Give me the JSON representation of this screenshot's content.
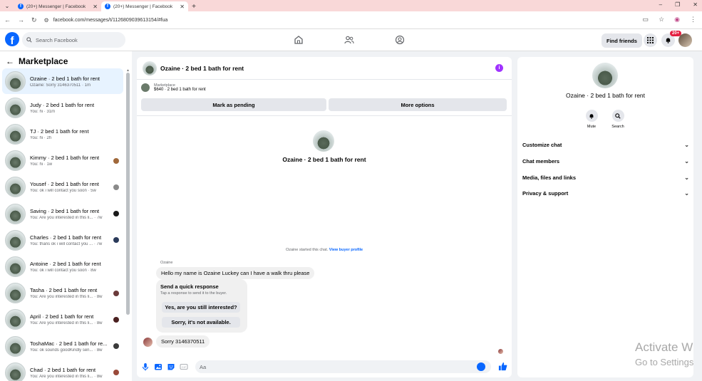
{
  "browser": {
    "tabs": [
      {
        "title": "(20+) Messenger | Facebook",
        "active": false
      },
      {
        "title": "(20+) Messenger | Facebook",
        "active": true
      }
    ],
    "url": "facebook.com/messages/t/1126809039613154/#fua"
  },
  "header": {
    "logo": "f",
    "search_placeholder": "Search Facebook",
    "find_friends": "Find friends",
    "notification_badge": "20+"
  },
  "sidebar": {
    "title": "Marketplace",
    "conversations": [
      {
        "name": "Ozaine · 2 bed 1 bath for rent",
        "preview": "Ozaine: Sorry 3146370511 · 1m",
        "active": true,
        "mini": ""
      },
      {
        "name": "Judy · 2 bed 1 bath for rent",
        "preview": "You: hi · 31m",
        "active": false,
        "mini": ""
      },
      {
        "name": "TJ · 2 bed 1 bath for rent",
        "preview": "You: hi · 2h",
        "active": false,
        "mini": ""
      },
      {
        "name": "Kimmy · 2 bed 1 bath for rent",
        "preview": "You: hi · 1w",
        "active": false,
        "mini": "#a0683a"
      },
      {
        "name": "Yousef · 2 bed 1 bath for rent",
        "preview": "You: ok i will contact you soon · 5w",
        "active": false,
        "mini": "#8a8a8a"
      },
      {
        "name": "Saving · 2 bed 1 bath for rent",
        "preview": "You: Are you interested in this li... · 7w",
        "active": false,
        "mini": "#1a1a1a"
      },
      {
        "name": "Charles · 2 bed 1 bath for rent",
        "preview": "You: thans ok i will contact you ... · 7w",
        "active": false,
        "mini": "#2a3a5a"
      },
      {
        "name": "Antoine · 2 bed 1 bath for rent",
        "preview": "You: ok i will contact you soon · 8w",
        "active": false,
        "mini": ""
      },
      {
        "name": "Tasha · 2 bed 1 bath for rent",
        "preview": "You: Are you interested in this li... · 8w",
        "active": false,
        "mini": "#6a3a3a"
      },
      {
        "name": "April · 2 bed 1 bath for rent",
        "preview": "You: Are you interested in this li... · 8w",
        "active": false,
        "mini": "#4a2020"
      },
      {
        "name": "ToshaMac · 2 bed 1 bath for re...",
        "preview": "You: ok sounds goodKindly sen... · 8w",
        "active": false,
        "mini": "#3a3a3a"
      },
      {
        "name": "Chad · 2 bed 1 bath for rent",
        "preview": "You: Are you interested in this li... · 8w",
        "active": false,
        "mini": "#9a4a3a"
      }
    ]
  },
  "chat": {
    "title": "Ozaine · 2 bed 1 bath for rent",
    "marketplace_label": "Marketplace",
    "listing": "$640 · 2 bed 1 bath for rent",
    "mark_pending": "Mark as pending",
    "more_options": "More options",
    "center_title": "Ozaine · 2 bed 1 bath for rent",
    "started_text": "Ozaine started this chat.",
    "view_buyer": "View buyer profile",
    "sender_name": "Ozaine",
    "message1": "Hello my name  is Ozaine Luckey can I have a walk thru please",
    "quick_title": "Send a quick response",
    "quick_sub": "Tap a response to send it to the buyer.",
    "quick_1": "Yes, are you still interested?",
    "quick_2": "Sorry, it's not available.",
    "message2": "Sorry 3146370511",
    "composer_placeholder": "Aa"
  },
  "details": {
    "name": "Ozaine · 2 bed 1 bath for rent",
    "mute": "Mute",
    "search": "Search",
    "sections": [
      "Customize chat",
      "Chat members",
      "Media, files and links",
      "Privacy & support"
    ]
  },
  "watermark": {
    "line1": "Activate W",
    "line2": "Go to Settings"
  },
  "colors": {
    "accent": "#0866ff",
    "info": "#a033ff",
    "active_row": "#e7f3ff"
  }
}
